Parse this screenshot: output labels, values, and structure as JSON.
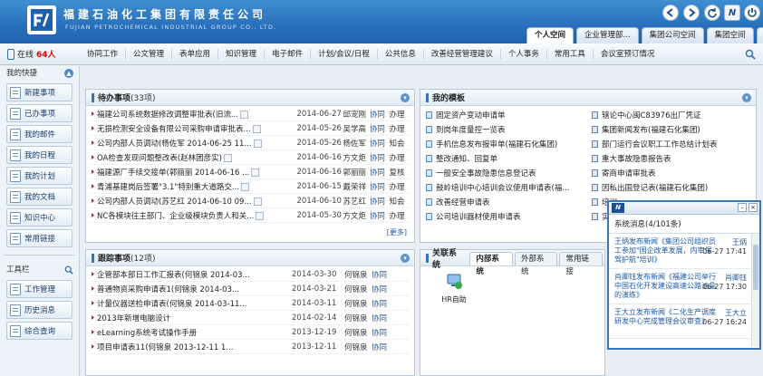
{
  "header": {
    "company_cn": "福建石油化工集团有限责任公司",
    "company_en": "FUJIAN PETROCHEMICAL INDUSTRIAL GROUP CO., LTD.",
    "tabs": [
      {
        "label": "个人空间",
        "active": true
      },
      {
        "label": "企业管理部...",
        "active": false
      },
      {
        "label": "集团公司空间",
        "active": false
      },
      {
        "label": "集团空间",
        "active": false
      },
      {
        "label": "»",
        "active": false
      }
    ]
  },
  "menubar": {
    "online_prefix": "在线",
    "online_count": "64人",
    "items": [
      "协同工作",
      "公文管理",
      "表单应用",
      "知识管理",
      "电子邮件",
      "计划/会议/日程",
      "公共信息",
      "改善经营管理建议",
      "个人事务",
      "常用工具",
      "会议室预订情况"
    ]
  },
  "sidebar": {
    "quick_title": "我的快捷",
    "quick_items": [
      "新建事项",
      "已办事项",
      "我的邮件",
      "我的日程",
      "我的计划",
      "我的文档",
      "知识中心",
      "常用链接"
    ],
    "tools_title": "工具栏",
    "tool_items": [
      "工作管理",
      "历史消息",
      "综合查询"
    ]
  },
  "todo": {
    "title": "待办事项",
    "count": "(33项)",
    "more": "[更多]",
    "rows": [
      {
        "title": "福建公司系统数据修改调整审批表(旧流...",
        "date": "2014-06-27",
        "person": "邱宠刚",
        "cat": "协同",
        "act": "办理"
      },
      {
        "title": "无损检测安全设备有限公司采购申请审批表...",
        "date": "2014-05-26",
        "person": "吴学高",
        "cat": "协同",
        "act": "办理"
      },
      {
        "title": "公司内部人员调动(杨佐军 2014-06-25 11...",
        "date": "2014-05-26",
        "person": "杨佐军",
        "cat": "协同",
        "act": "知会"
      },
      {
        "title": "OA检查发现问题整改表(赵林团彦实)",
        "date": "2014-06-16",
        "person": "方文炬",
        "cat": "协同",
        "act": "办理"
      },
      {
        "title": "福建源厂手续交接单(郭丽丽 2014-06-16 ...",
        "date": "2014-06-16",
        "person": "郭丽丽",
        "cat": "协同",
        "act": "复核"
      },
      {
        "title": "青浦基建岗后签署\"3.1\"特别重大道路交...",
        "date": "2014-06-15",
        "person": "戴荣祥",
        "cat": "协同",
        "act": "办理"
      },
      {
        "title": "公司内部人员调动(苏艺红 2014-06-10 09...",
        "date": "2014-06-10",
        "person": "苏艺红",
        "cat": "协同",
        "act": "知会"
      },
      {
        "title": "NC各模块往主部门、企业级模块负责人和关...",
        "date": "2014-05-30",
        "person": "方文炬",
        "cat": "协同",
        "act": "办理"
      }
    ]
  },
  "templates": {
    "title": "我的模板",
    "left": [
      "固定资产变动申请单",
      "到岗年度量控一览表",
      "手机信息发布报审单(福建石化集团)",
      "整改通知、回复单",
      "一般安全事故隐患信息登记表",
      "鼓岭培训中心培训会议使用申请表(福...",
      "改善经营申请表",
      "公司培训器材使用申请表"
    ],
    "right": [
      "辖论中心闽C83976出厂凭证",
      "集团新闻发布(福建石化集团)",
      "部门运行会议职工工作总结计划表",
      "重大事故隐患报告表",
      "寄商申请审批表",
      "因私出国登记表(福建石化集团)",
      "培训...",
      "实施..."
    ]
  },
  "followup": {
    "title": "跟踪事项",
    "count": "(12项)",
    "rows": [
      {
        "title": "企管部本部日工作汇报表(何锦泉 2014-03...",
        "date": "2014-03-30",
        "person": "何锦泉",
        "cat": "协同"
      },
      {
        "title": "普通物资采购申请表1(何锦泉 2014-03...",
        "date": "2014-03-21",
        "person": "何锦泉",
        "cat": "协同"
      },
      {
        "title": "计量仪器送检申请表(何锦泉 2014-03-11...",
        "date": "2014-03-11",
        "person": "何锦泉",
        "cat": "协同"
      },
      {
        "title": "2013年新增电脑设计",
        "date": "2014-02-14",
        "person": "何锦泉",
        "cat": "协同"
      },
      {
        "title": "eLearning系统考试操作手册",
        "date": "2013-12-19",
        "person": "何锦泉",
        "cat": "协同"
      },
      {
        "title": "项目申请表11(何锦泉 2013-12-11 1...",
        "date": "2013-12-11",
        "person": "何锦泉",
        "cat": "协同"
      }
    ]
  },
  "systems": {
    "title": "关联系统",
    "tabs": [
      "内部系统",
      "外部系统",
      "常用链接"
    ],
    "app_label": "HR自助"
  },
  "popup": {
    "logo": "N",
    "title": "系统消息(4/101条)",
    "messages": [
      {
        "text": "王炳发布新闻《集团公司组织员工参加\"国企改革发展，内审保驾护航\"培训》",
        "who": "王炳",
        "time": "06-27 17:41"
      },
      {
        "text": "肖卿钰发布新闻《福建公司举行中国石化开发建设高速公路油品的演练》",
        "who": "肖卿钰",
        "time": "06-27 17:30"
      },
      {
        "text": "王大立发布新闻《二化生产调度研发中心完成管理会议审查》",
        "who": "王大立",
        "time": "06-27 16:24"
      }
    ]
  }
}
